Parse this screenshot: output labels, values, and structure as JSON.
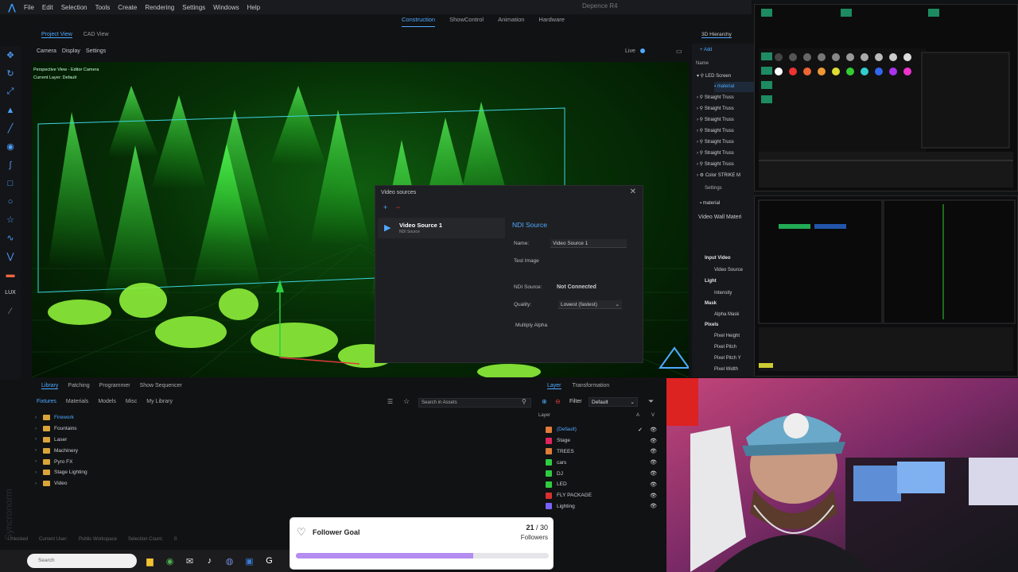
{
  "app": {
    "title": "Depence R4",
    "menu": [
      "File",
      "Edit",
      "Selection",
      "Tools",
      "Create",
      "Rendering",
      "Settings",
      "Windows",
      "Help"
    ],
    "modes": [
      "Construction",
      "ShowControl",
      "Animation",
      "Hardware"
    ],
    "active_mode": "Construction"
  },
  "viewport": {
    "tabs": [
      "Project View",
      "CAD View"
    ],
    "sub": [
      "Camera",
      "Display",
      "Settings"
    ],
    "live_label": "Live",
    "info_line1": "Perspective View - Editor Camera",
    "info_line2": "Current Layer: Default"
  },
  "dialog": {
    "title": "Video sources",
    "close": "✕",
    "source_name": "Video Source 1",
    "source_type": "NDI Source",
    "props_header": "NDI Source",
    "name_label": "Name:",
    "name_value": "Video Source 1",
    "test_image": "Test Image",
    "ndi_label": "NDI Source:",
    "ndi_value": "Not Connected",
    "quality_label": "Quality:",
    "quality_value": "Lowest (fastest)",
    "multiply_alpha": "Multiply Alpha"
  },
  "hierarchy": {
    "tab": "3D Hierarchy",
    "add": "Add",
    "name_col": "Name",
    "items": [
      "LED Screen",
      "material",
      "Straight Truss",
      "Straight Truss",
      "Straight Truss",
      "Straight Truss",
      "Straight Truss",
      "Straight Truss",
      "Straight Truss",
      "Color STRIKE M"
    ],
    "settings": "Settings",
    "sel_material": "material",
    "video_wall": "Video Wall Materi",
    "sections": [
      {
        "head": "Input Video",
        "items": [
          "Video Source"
        ]
      },
      {
        "head": "Light",
        "items": [
          "Intensity"
        ]
      },
      {
        "head": "Mask",
        "items": [
          "Alpha Mask"
        ]
      },
      {
        "head": "Pixels",
        "items": [
          "Pixel Height",
          "Pixel Pitch",
          "Pixel Pitch Y",
          "Pixel Width"
        ]
      }
    ]
  },
  "library": {
    "tabs": [
      "Library",
      "Patching",
      "Programmer",
      "Show Sequencer"
    ],
    "sub": [
      "Fixtures",
      "Materials",
      "Models",
      "Misc",
      "My Library"
    ],
    "search_placeholder": "Search in Assets",
    "folders": [
      "Firework",
      "Fountains",
      "Laser",
      "Machinery",
      "Pyro FX",
      "Stage Lighting",
      "Video"
    ]
  },
  "layers": {
    "tabs": [
      "Layer",
      "Transformation"
    ],
    "filter_label": "Filter",
    "filter_value": "Default",
    "col_layer": "Layer",
    "col_a": "A",
    "col_v": "V",
    "items": [
      {
        "name": "(Default)",
        "color": "#e07b39"
      },
      {
        "name": "Stage",
        "color": "#e0245e"
      },
      {
        "name": "TREES",
        "color": "#e07b39"
      },
      {
        "name": "cars",
        "color": "#2ecc40"
      },
      {
        "name": "DJ",
        "color": "#2ecc40"
      },
      {
        "name": "LED",
        "color": "#2ecc40"
      },
      {
        "name": "FLY PACKAGE",
        "color": "#d63031"
      },
      {
        "name": "Lighting",
        "color": "#7b61ff"
      }
    ]
  },
  "status": {
    "items": [
      "Unlocked",
      "Current User:",
      "Public Workspace",
      "Selection Count:",
      "0"
    ]
  },
  "taskbar": {
    "search_placeholder": "Search"
  },
  "goal": {
    "title": "Follower Goal",
    "current": "21",
    "total": "/ 30",
    "label": "Followers",
    "progress": 0.7
  },
  "watermark": "Syncronorm"
}
